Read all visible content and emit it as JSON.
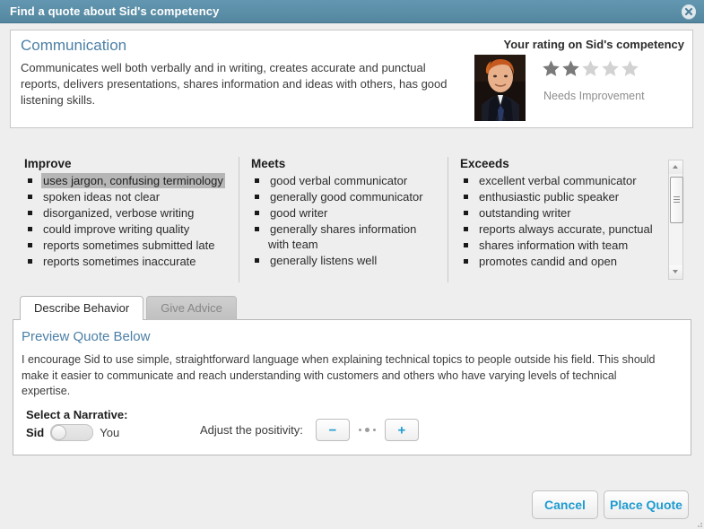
{
  "window": {
    "title": "Find a quote about Sid's competency",
    "close_icon": "close-circle-icon",
    "titlebar_color": "#5b91ac"
  },
  "competency": {
    "name": "Communication",
    "description": "Communicates well both verbally and in writing, creates accurate and punctual reports, delivers presentations, shares information and ideas with others, has good listening skills.",
    "rating_heading": "Your rating on Sid's competency",
    "rating_value": 2,
    "rating_max": 5,
    "rating_label": "Needs Improvement",
    "avatar_alt": "Sid portrait photo",
    "star_filled_color": "#7a7a7a",
    "star_empty_color": "#d2d2d2",
    "title_color": "#4b7fa5"
  },
  "behavior_columns": [
    {
      "heading": "Improve",
      "items": [
        {
          "text": "uses jargon, confusing terminology",
          "selected": true
        },
        {
          "text": "spoken ideas not clear",
          "selected": false
        },
        {
          "text": "disorganized, verbose writing",
          "selected": false
        },
        {
          "text": "could improve writing quality",
          "selected": false
        },
        {
          "text": "reports sometimes submitted late",
          "selected": false
        },
        {
          "text": "reports sometimes inaccurate",
          "selected": false
        }
      ]
    },
    {
      "heading": "Meets",
      "items": [
        {
          "text": "good verbal communicator",
          "selected": false
        },
        {
          "text": "generally good communicator",
          "selected": false
        },
        {
          "text": "good writer",
          "selected": false
        },
        {
          "text": "generally shares information with team",
          "selected": false
        },
        {
          "text": "generally listens well",
          "selected": false
        }
      ]
    },
    {
      "heading": "Exceeds",
      "items": [
        {
          "text": "excellent verbal communicator",
          "selected": false
        },
        {
          "text": "enthusiastic public speaker",
          "selected": false
        },
        {
          "text": "outstanding writer",
          "selected": false
        },
        {
          "text": "reports always accurate, punctual",
          "selected": false
        },
        {
          "text": "shares information with team",
          "selected": false
        },
        {
          "text": "promotes candid and open",
          "selected": false
        }
      ]
    }
  ],
  "scrollbar": {
    "up_icon": "triangle-up-icon",
    "down_icon": "triangle-down-icon",
    "thumb_icon": "scrollbar-thumb-grip"
  },
  "tabs": [
    {
      "label": "Describe Behavior",
      "active": true
    },
    {
      "label": "Give Advice",
      "active": false
    }
  ],
  "preview": {
    "title": "Preview Quote Below",
    "text": "I encourage Sid to use simple, straightforward language when explaining technical topics to people outside his field. This should make it easier to communicate and reach understanding with customers and others who have varying levels of technical expertise."
  },
  "narrative": {
    "label": "Select a Narrative:",
    "left_option": "Sid",
    "right_option": "You",
    "selected": "Sid"
  },
  "positivity": {
    "label": "Adjust the positivity:",
    "decrease_label": "−",
    "increase_label": "+",
    "level_dots": 3,
    "accent_color": "#1f9bd1"
  },
  "footer": {
    "cancel_label": "Cancel",
    "place_label": "Place Quote"
  }
}
